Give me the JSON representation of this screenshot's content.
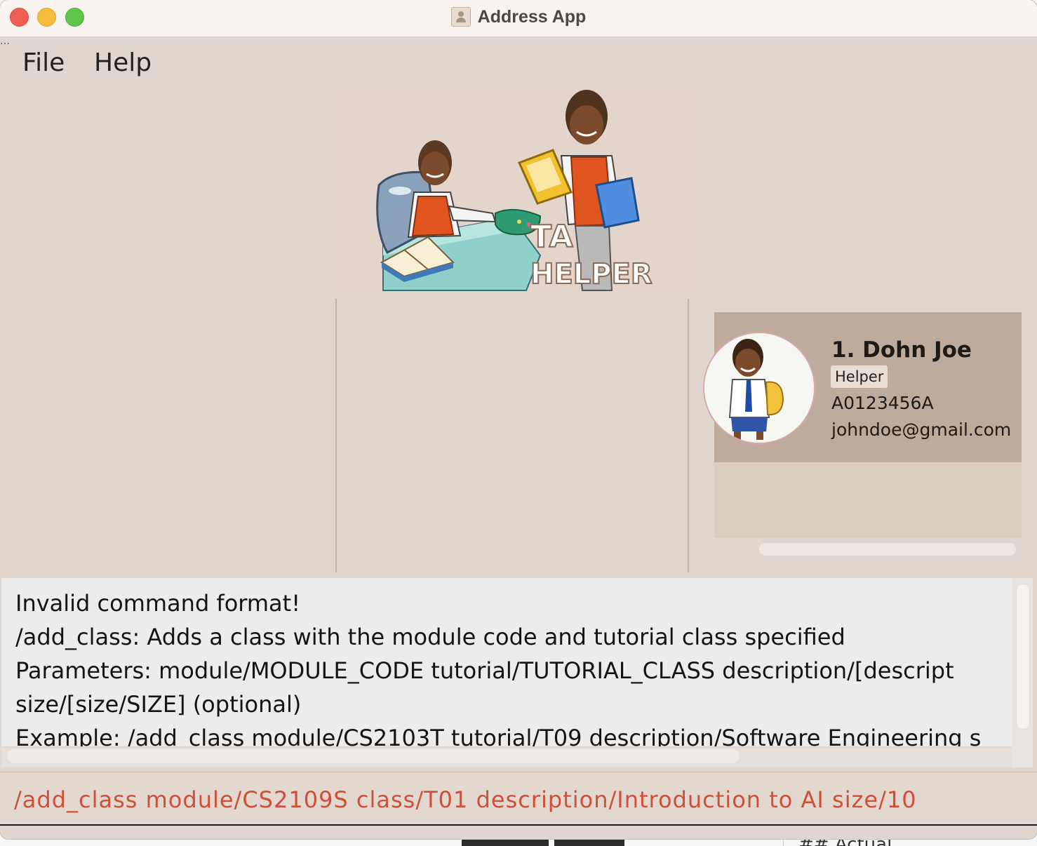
{
  "window": {
    "title": "Address App"
  },
  "menu": {
    "items": [
      "File",
      "Help"
    ]
  },
  "banner": {
    "logo_text": "TA HELPER"
  },
  "person_list": [
    {
      "index_name": "1.  Dohn Joe",
      "tag": "Helper",
      "student_id": "A0123456A",
      "email": "johndoe@gmail.com"
    }
  ],
  "result_display": {
    "lines": [
      "Invalid command format!",
      "/add_class: Adds a class with the module code and tutorial class specified",
      "Parameters: module/MODULE_CODE tutorial/TUTORIAL_CLASS description/[descript",
      "size/[size/SIZE] (optional)",
      "Example: /add_class module/CS2103T tutorial/T09 description/Software Engineering s"
    ]
  },
  "command_box": {
    "value": "/add_class module/CS2109S class/T01 description/Introduction to AI size/10"
  },
  "background": {
    "partial_text": "## Actual"
  }
}
